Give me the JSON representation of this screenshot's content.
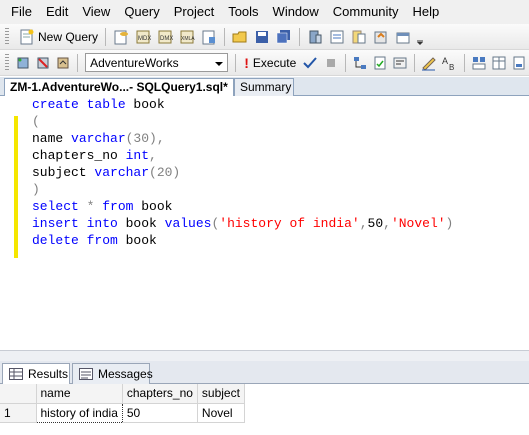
{
  "menu": [
    "File",
    "Edit",
    "View",
    "Query",
    "Project",
    "Tools",
    "Window",
    "Community",
    "Help"
  ],
  "toolbar1": {
    "new_query_label": "New Query"
  },
  "toolbar2": {
    "database": "AdventureWorks",
    "execute_label": "Execute"
  },
  "tabs": {
    "active": "ZM-1.AdventureWo...- SQLQuery1.sql*",
    "summary": "Summary"
  },
  "editor": {
    "lines": [
      [
        {
          "t": "create table ",
          "c": "kw"
        },
        {
          "t": "book",
          "c": "pl"
        }
      ],
      [
        {
          "t": "(",
          "c": "op"
        }
      ],
      [
        {
          "t": "name ",
          "c": "pl"
        },
        {
          "t": "varchar",
          "c": "kw"
        },
        {
          "t": "(30),",
          "c": "op"
        }
      ],
      [
        {
          "t": "chapters_no ",
          "c": "pl"
        },
        {
          "t": "int",
          "c": "kw"
        },
        {
          "t": ",",
          "c": "op"
        }
      ],
      [
        {
          "t": "subject ",
          "c": "pl"
        },
        {
          "t": "varchar",
          "c": "kw"
        },
        {
          "t": "(20)",
          "c": "op"
        }
      ],
      [
        {
          "t": ")",
          "c": "op"
        }
      ],
      [
        {
          "t": "select ",
          "c": "kw"
        },
        {
          "t": "* ",
          "c": "op"
        },
        {
          "t": "from ",
          "c": "kw"
        },
        {
          "t": "book",
          "c": "pl"
        }
      ],
      [
        {
          "t": "insert into ",
          "c": "kw"
        },
        {
          "t": "book ",
          "c": "pl"
        },
        {
          "t": "values",
          "c": "kw"
        },
        {
          "t": "(",
          "c": "op"
        },
        {
          "t": "'history of india'",
          "c": "str"
        },
        {
          "t": ",",
          "c": "op"
        },
        {
          "t": "50",
          "c": "pl"
        },
        {
          "t": ",",
          "c": "op"
        },
        {
          "t": "'Novel'",
          "c": "str"
        },
        {
          "t": ")",
          "c": "op"
        }
      ],
      [
        {
          "t": "delete from ",
          "c": "kw"
        },
        {
          "t": "book",
          "c": "pl"
        }
      ]
    ]
  },
  "results": {
    "tab_results": "Results",
    "tab_messages": "Messages",
    "columns": [
      "name",
      "chapters_no",
      "subject"
    ],
    "rows": [
      {
        "num": "1",
        "cells": [
          "history of india",
          "50",
          "Novel"
        ]
      }
    ]
  }
}
